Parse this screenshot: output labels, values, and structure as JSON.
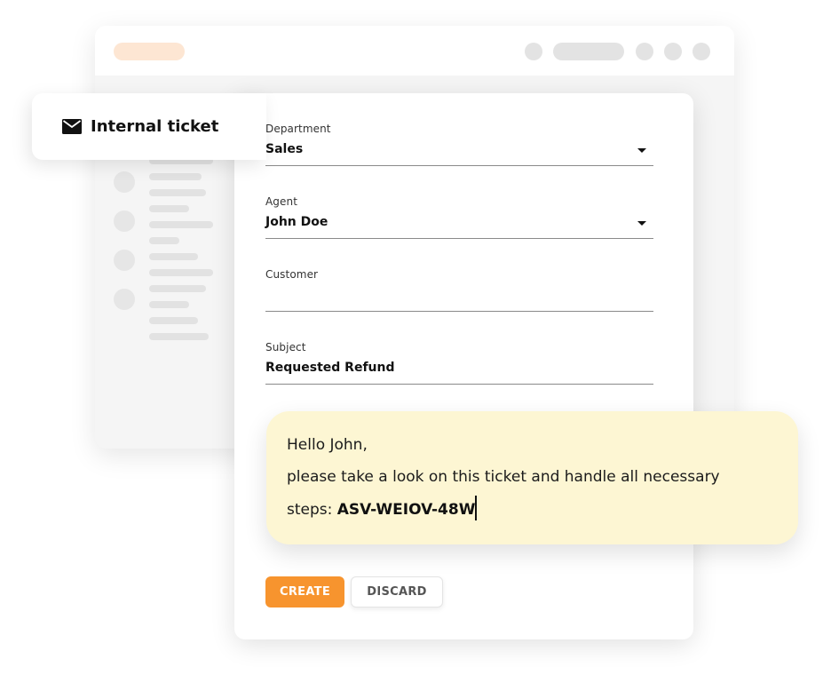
{
  "colors": {
    "accent": "#f7942e",
    "message_bg": "#fdf6d3",
    "skeleton": "#e2e2e2",
    "skeleton_accent": "#fde6d3"
  },
  "ticket_tab": {
    "icon": "envelope-icon",
    "title": "Internal ticket"
  },
  "form": {
    "department": {
      "label": "Department",
      "value": "Sales"
    },
    "agent": {
      "label": "Agent",
      "value": "John Doe"
    },
    "customer": {
      "label": "Customer",
      "value": ""
    },
    "subject": {
      "label": "Subject",
      "value": "Requested Refund"
    }
  },
  "message": {
    "line1": "Hello John,",
    "line2": "please take a look on this ticket and handle all necessary",
    "line3_prefix": "steps: ",
    "ticket_code": "ASV-WEIOV-48W"
  },
  "buttons": {
    "create": "CREATE",
    "discard": "DISCARD"
  }
}
